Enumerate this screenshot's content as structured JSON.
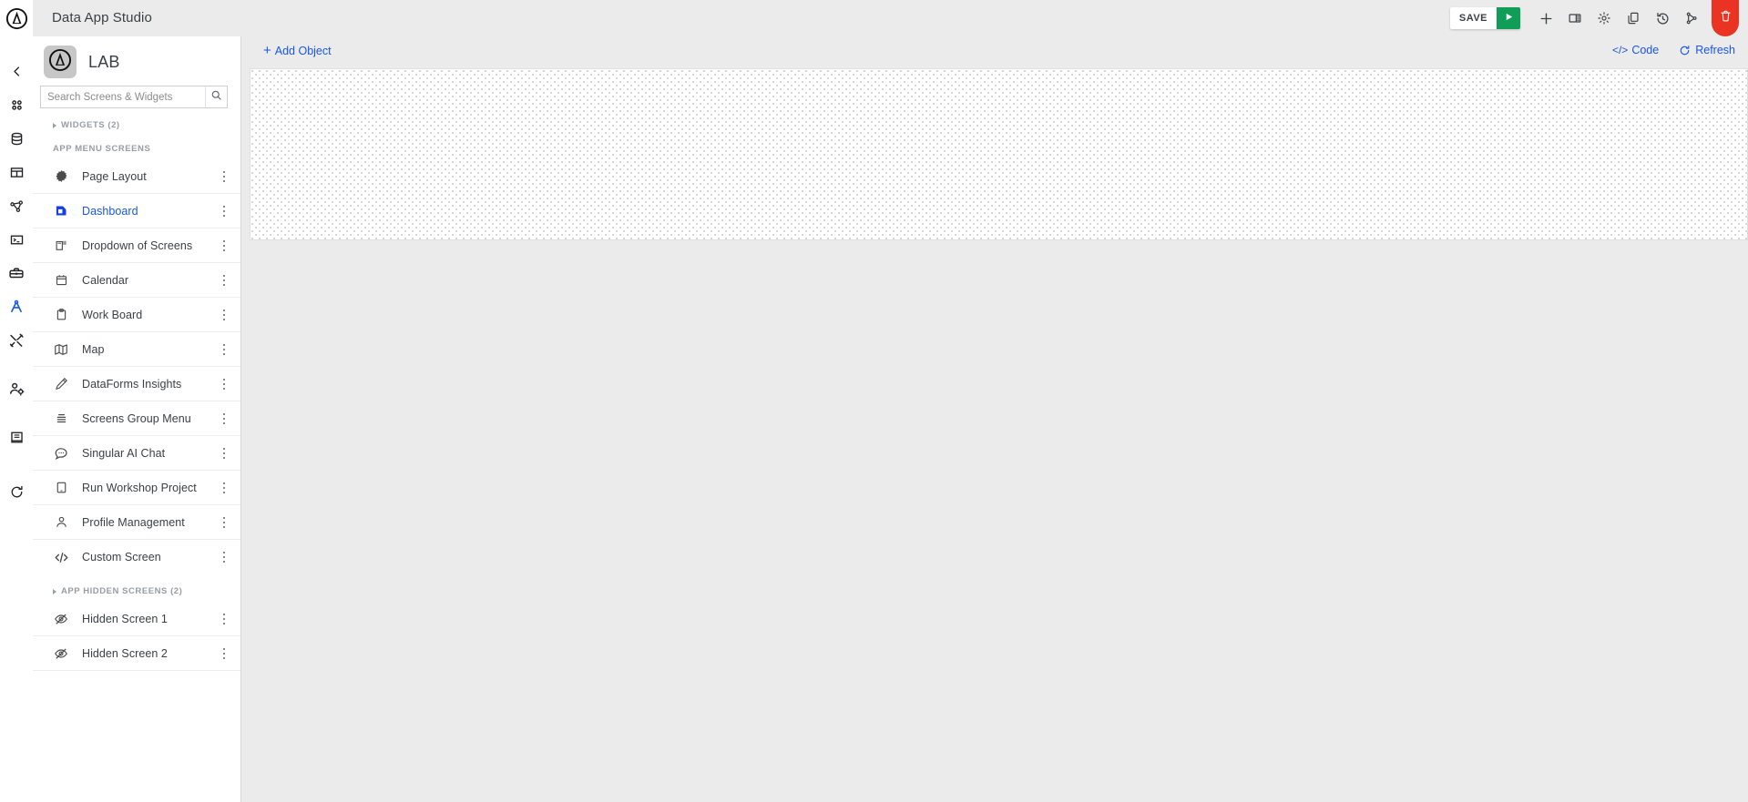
{
  "header": {
    "title": "Data App Studio",
    "brand_logo_icon": "studio-circle-logo",
    "toolbar": {
      "save_label": "SAVE",
      "run_icon": "play-icon",
      "add_icon": "plus-icon",
      "panel_icon": "layout-panel-icon",
      "settings_icon": "gear-icon",
      "copy_icon": "copy-icon",
      "history_icon": "history-clock-icon",
      "branch_icon": "branch-merge-icon",
      "delete_icon": "trash-icon",
      "accent_green": "#0f9d58",
      "accent_red": "#ea3323"
    }
  },
  "left_rail": {
    "logo_icon": "studio-circle-logo",
    "items": [
      {
        "icon": "chevron-left-icon",
        "name": "collapse-rail"
      },
      {
        "icon": "apps-grid-icon",
        "name": "apps"
      },
      {
        "icon": "database-icon",
        "name": "database"
      },
      {
        "icon": "table-icon",
        "name": "tables"
      },
      {
        "icon": "workflow-node-icon",
        "name": "workflows"
      },
      {
        "icon": "terminal-icon",
        "name": "terminal"
      },
      {
        "icon": "toolbox-icon",
        "name": "toolbox"
      },
      {
        "icon": "compass-drafting-icon",
        "name": "studio",
        "active": true
      },
      {
        "icon": "tools-wrench-screwdriver-icon",
        "name": "utilities"
      },
      {
        "icon": "user-settings-icon",
        "name": "user-admin"
      },
      {
        "icon": "book-icon",
        "name": "docs"
      },
      {
        "icon": "refresh-icon",
        "name": "refresh"
      }
    ],
    "active_color": "#1a56e8"
  },
  "sidebar": {
    "app_logo_icon": "studio-circle-logo",
    "app_name": "LAB",
    "search": {
      "placeholder": "Search Screens & Widgets",
      "value": "",
      "icon": "search-icon"
    },
    "widgets_section": {
      "label": "WIDGETS (2)",
      "collapsed": true
    },
    "app_menu_section": {
      "label": "APP MENU SCREENS"
    },
    "screens": [
      {
        "label": "Page Layout",
        "icon": "page-layout-burst-icon",
        "selected": false
      },
      {
        "label": "Dashboard",
        "icon": "dashboard-icon",
        "selected": true
      },
      {
        "label": "Dropdown of Screens",
        "icon": "dropdown-screens-icon",
        "selected": false
      },
      {
        "label": "Calendar",
        "icon": "calendar-icon",
        "selected": false
      },
      {
        "label": "Work Board",
        "icon": "clipboard-icon",
        "selected": false
      },
      {
        "label": "Map",
        "icon": "map-icon",
        "selected": false
      },
      {
        "label": "DataForms Insights",
        "icon": "pencil-icon",
        "selected": false
      },
      {
        "label": "Screens Group Menu",
        "icon": "menu-lines-icon",
        "selected": false
      },
      {
        "label": "Singular AI Chat",
        "icon": "chat-bubble-dots-icon",
        "selected": false
      },
      {
        "label": "Run Workshop Project",
        "icon": "tablet-icon",
        "selected": false
      },
      {
        "label": "Profile Management",
        "icon": "person-icon",
        "selected": false
      },
      {
        "label": "Custom Screen",
        "icon": "code-brackets-icon",
        "selected": false
      }
    ],
    "hidden_section": {
      "label": "APP HIDDEN SCREENS (2)",
      "collapsed": true
    },
    "hidden_screens": [
      {
        "label": "Hidden Screen 1",
        "icon": "eye-off-icon"
      },
      {
        "label": "Hidden Screen 2",
        "icon": "eye-off-icon"
      }
    ],
    "row_menu_icon": "more-vertical-icon",
    "selected_color": "#1a56e8"
  },
  "main": {
    "add_object_label": "Add Object",
    "add_object_icon": "plus-icon",
    "code_label": "Code",
    "code_icon": "code-brackets-icon",
    "refresh_label": "Refresh",
    "refresh_icon": "refresh-icon",
    "link_color": "#1a56e8",
    "canvas": {
      "name": "design-canvas",
      "grid": "dotted"
    }
  }
}
